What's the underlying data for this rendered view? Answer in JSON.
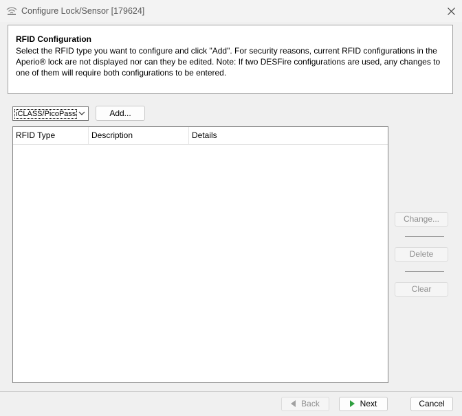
{
  "window": {
    "title": "Configure Lock/Sensor [179624]"
  },
  "header": {
    "title": "RFID Configuration",
    "description": "Select the RFID type you want to configure and click \"Add\". For security reasons, current RFID configurations in the Aperio® lock are not displayed nor can they be edited. Note: If two DESFire configurations are used, any changes to one of them will require both configurations to be entered."
  },
  "rfid_select": {
    "selected": "iCLASS/PicoPass"
  },
  "add_button": "Add...",
  "table": {
    "columns": [
      "RFID Type",
      "Description",
      "Details"
    ],
    "rows": []
  },
  "side_buttons": {
    "change": "Change...",
    "delete": "Delete",
    "clear": "Clear"
  },
  "footer": {
    "back": "Back",
    "next": "Next",
    "cancel": "Cancel"
  },
  "colors": {
    "next_arrow": "#2e9e3e",
    "back_arrow": "#a0a0a0"
  }
}
